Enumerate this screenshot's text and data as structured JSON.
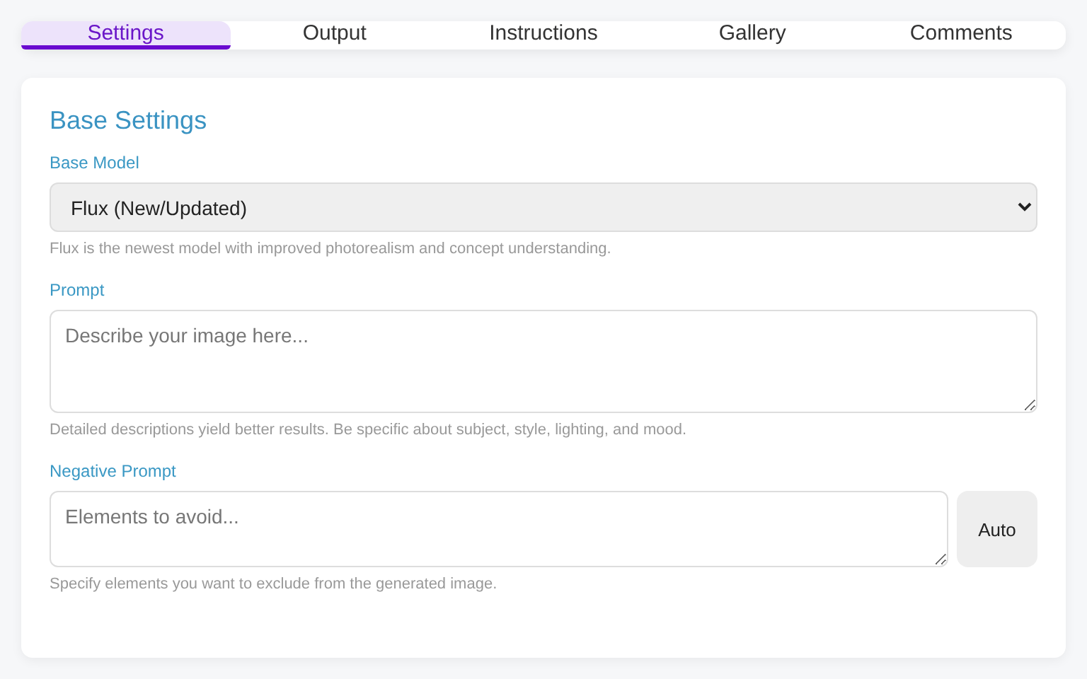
{
  "tabs": [
    {
      "label": "Settings",
      "selected": true
    },
    {
      "label": "Output",
      "selected": false
    },
    {
      "label": "Instructions",
      "selected": false
    },
    {
      "label": "Gallery",
      "selected": false
    },
    {
      "label": "Comments",
      "selected": false
    }
  ],
  "section": {
    "title": "Base Settings",
    "fields": [
      {
        "kind": "select",
        "label": "Base Model",
        "value": "Flux (New/Updated)",
        "hint": "Flux is the newest model with improved photorealism and concept understanding."
      },
      {
        "kind": "textarea",
        "label": "Prompt",
        "placeholder": "Describe your image here...",
        "hint": "Detailed descriptions yield better results. Be specific about subject, style, lighting, and mood."
      },
      {
        "kind": "textarea_button",
        "label": "Negative Prompt",
        "placeholder": "Elements to avoid...",
        "button": "Auto",
        "hint": "Specify elements you want to exclude from the generated image."
      }
    ]
  }
}
